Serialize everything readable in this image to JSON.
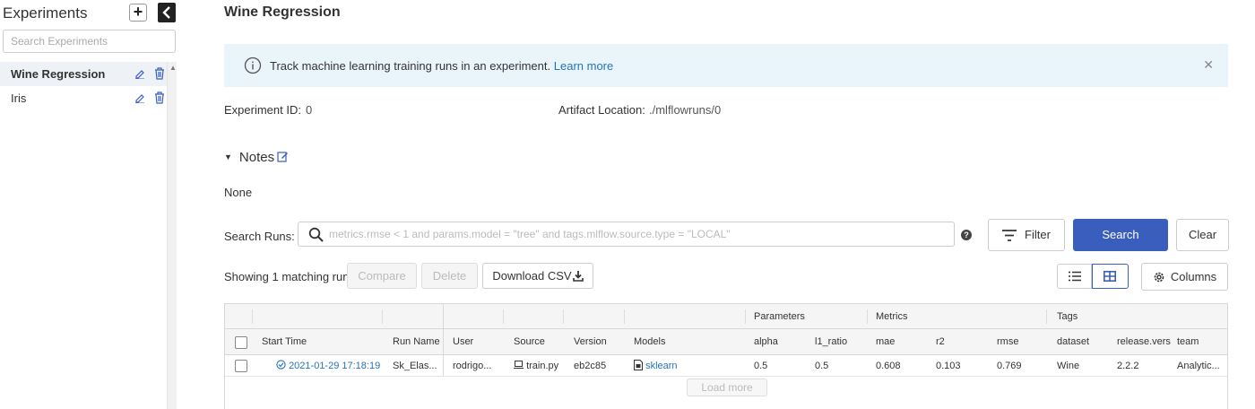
{
  "sidebar": {
    "title": "Experiments",
    "add_label": "+",
    "search_placeholder": "Search Experiments",
    "items": [
      {
        "label": "Wine Regression",
        "active": true
      },
      {
        "label": "Iris",
        "active": false
      }
    ]
  },
  "page": {
    "title": "Wine Regression",
    "banner": {
      "message": "Track machine learning training runs in an experiment.",
      "link": "Learn more",
      "close": "✕"
    },
    "experiment_id_label": "Experiment ID:",
    "experiment_id_value": "0",
    "artifact_label": "Artifact Location:",
    "artifact_value": "./mlflowruns/0",
    "notes_label": "Notes",
    "notes_body": "None"
  },
  "search": {
    "label": "Search Runs:",
    "placeholder": "metrics.rmse < 1 and params.model = \"tree\" and tags.mlflow.source.type = \"LOCAL\"",
    "help": "?",
    "filter_label": "Filter",
    "search_label": "Search",
    "clear_label": "Clear"
  },
  "toolbar": {
    "showing": "Showing 1 matching run",
    "compare_label": "Compare",
    "delete_label": "Delete",
    "download_label": "Download CSV",
    "columns_label": "Columns"
  },
  "table": {
    "groups": {
      "parameters": "Parameters",
      "metrics": "Metrics",
      "tags": "Tags"
    },
    "headers": {
      "start_time": "Start Time",
      "run_name": "Run Name",
      "user": "User",
      "source": "Source",
      "version": "Version",
      "models": "Models",
      "alpha": "alpha",
      "l1_ratio": "l1_ratio",
      "mae": "mae",
      "r2": "r2",
      "rmse": "rmse",
      "dataset": "dataset",
      "release": "release.vers",
      "team": "team"
    },
    "rows": [
      {
        "start_time": "2021-01-29 17:18:19",
        "run_name": "Sk_Elas...",
        "user": "rodrigo...",
        "source": "train.py",
        "version": "eb2c85",
        "models": "sklearn",
        "alpha": "0.5",
        "l1_ratio": "0.5",
        "mae": "0.608",
        "r2": "0.103",
        "rmse": "0.769",
        "dataset": "Wine",
        "release": "2.2.2",
        "team": "Analytic..."
      }
    ],
    "load_more": "Load more"
  },
  "colors": {
    "accent": "#3a5ebd",
    "link": "#2374bb",
    "banner_bg": "#eaf4fb"
  }
}
